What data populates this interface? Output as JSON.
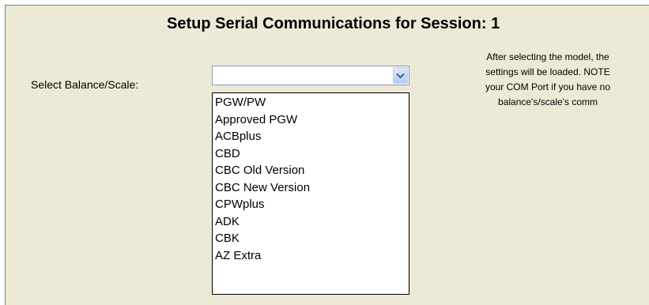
{
  "dialog": {
    "title": "Setup Serial Communications for Session: 1"
  },
  "balance_select": {
    "label": "Select Balance/Scale:",
    "value": "",
    "options": [
      "PGW/PW",
      "Approved PGW",
      "ACBplus",
      "CBD",
      "CBC Old Version",
      "CBC New Version",
      "CPWplus",
      "ADK",
      "CBK",
      "AZ Extra"
    ]
  },
  "info_text": {
    "lines": [
      "After selecting the model, the",
      "settings will be loaded. NOTE",
      "your COM Port if you have no",
      "balance's/scale's comm"
    ]
  },
  "icons": {
    "dropdown_arrow": "chevron-down-icon"
  },
  "colors": {
    "dialog_background": "#ECE9D6",
    "combo_button": "#B6CDF8",
    "arrow": "#4D6185"
  }
}
